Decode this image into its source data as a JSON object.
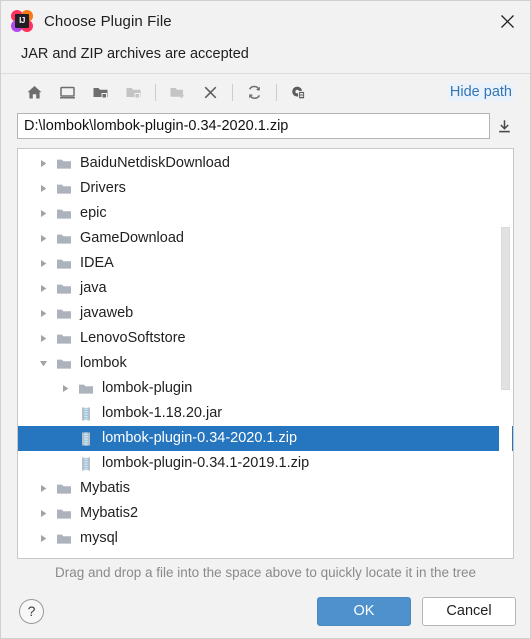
{
  "window": {
    "title": "Choose Plugin File",
    "app_icon": "intellij-idea-icon",
    "icon_text": "IJ",
    "close_label": "✕"
  },
  "subtitle": "JAR and ZIP archives are accepted",
  "toolbar": {
    "buttons": [
      {
        "name": "home-icon",
        "tooltip": "Home",
        "enabled": true
      },
      {
        "name": "desktop-icon",
        "tooltip": "Desktop",
        "enabled": true
      },
      {
        "name": "project-folder-icon",
        "tooltip": "Project Directory",
        "enabled": true
      },
      {
        "name": "module-folder-icon",
        "tooltip": "Module Directory",
        "enabled": false
      },
      {
        "name": "new-folder-icon",
        "tooltip": "New Folder",
        "enabled": false
      },
      {
        "name": "delete-icon",
        "tooltip": "Delete",
        "enabled": true
      },
      {
        "name": "refresh-icon",
        "tooltip": "Refresh",
        "enabled": true
      },
      {
        "name": "show-hidden-files-icon",
        "tooltip": "Show Hidden Files and Directories",
        "enabled": true
      }
    ],
    "hide_path_label": "Hide path"
  },
  "path_field": {
    "value": "D:\\lombok\\lombok-plugin-0.34-2020.1.zip",
    "placeholder": "",
    "dropdown_icon": "download-arrow-icon"
  },
  "tree": {
    "rows": [
      {
        "label": "BaiduNetdiskDownload",
        "depth": 0,
        "type": "folder",
        "state": "collapsed",
        "selected": false
      },
      {
        "label": "Drivers",
        "depth": 0,
        "type": "folder",
        "state": "collapsed",
        "selected": false
      },
      {
        "label": "epic",
        "depth": 0,
        "type": "folder",
        "state": "collapsed",
        "selected": false
      },
      {
        "label": "GameDownload",
        "depth": 0,
        "type": "folder",
        "state": "collapsed",
        "selected": false
      },
      {
        "label": "IDEA",
        "depth": 0,
        "type": "folder",
        "state": "collapsed",
        "selected": false
      },
      {
        "label": "java",
        "depth": 0,
        "type": "folder",
        "state": "collapsed",
        "selected": false
      },
      {
        "label": "javaweb",
        "depth": 0,
        "type": "folder",
        "state": "collapsed",
        "selected": false
      },
      {
        "label": "LenovoSoftstore",
        "depth": 0,
        "type": "folder",
        "state": "collapsed",
        "selected": false
      },
      {
        "label": "lombok",
        "depth": 0,
        "type": "folder",
        "state": "expanded",
        "selected": false
      },
      {
        "label": "lombok-plugin",
        "depth": 1,
        "type": "folder",
        "state": "collapsed",
        "selected": false
      },
      {
        "label": "lombok-1.18.20.jar",
        "depth": 1,
        "type": "archive",
        "state": "leaf",
        "selected": false
      },
      {
        "label": "lombok-plugin-0.34-2020.1.zip",
        "depth": 1,
        "type": "archive",
        "state": "leaf",
        "selected": true
      },
      {
        "label": "lombok-plugin-0.34.1-2019.1.zip",
        "depth": 1,
        "type": "archive",
        "state": "leaf",
        "selected": false
      },
      {
        "label": "Mybatis",
        "depth": 0,
        "type": "folder",
        "state": "collapsed",
        "selected": false
      },
      {
        "label": "Mybatis2",
        "depth": 0,
        "type": "folder",
        "state": "collapsed",
        "selected": false
      },
      {
        "label": "mysql",
        "depth": 0,
        "type": "folder",
        "state": "collapsed",
        "selected": false
      }
    ],
    "scrollbar": {
      "thumb_top_pct": 19,
      "thumb_height_pct": 40
    }
  },
  "hint": "Drag and drop a file into the space above to quickly locate it in the tree",
  "footer": {
    "help_label": "?",
    "ok_label": "OK",
    "cancel_label": "Cancel"
  },
  "colors": {
    "selection": "#2675bf",
    "link": "#3574b5",
    "primary_button": "#4f91cd",
    "folder": "#adb3bd",
    "window_bg": "#f2f2f2"
  }
}
